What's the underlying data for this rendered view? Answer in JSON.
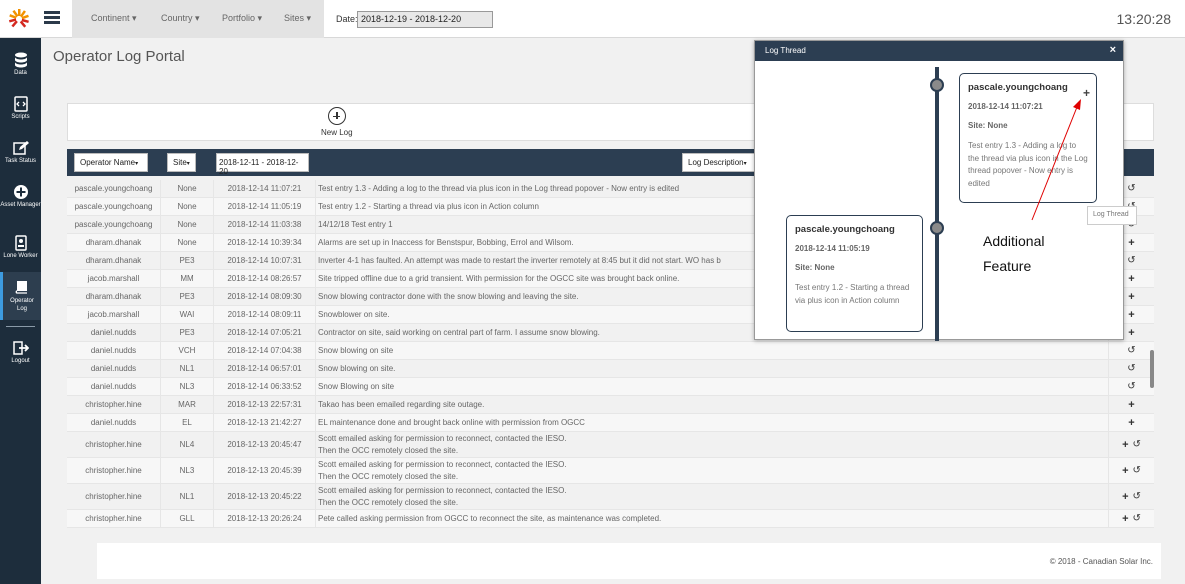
{
  "topbar": {
    "filters": [
      "Continent",
      "Country",
      "Portfolio",
      "Sites"
    ],
    "date_label": "Date:",
    "date_value": "2018-12-19 - 2018-12-20",
    "clock": "13:20:28"
  },
  "sidebar": {
    "items": [
      {
        "label": "Data",
        "icon": "database-icon"
      },
      {
        "label": "Scripts",
        "icon": "script-icon"
      },
      {
        "label": "Task Status",
        "icon": "edit-icon"
      },
      {
        "label": "Asset Manager",
        "icon": "plus-circle-icon"
      },
      {
        "label": "Lone Worker",
        "icon": "badge-icon"
      },
      {
        "label": "Operator Log",
        "icon": "book-icon"
      },
      {
        "label": "Logout",
        "icon": "logout-icon"
      }
    ]
  },
  "page": {
    "title": "Operator Log Portal",
    "new_log_label": "New Log"
  },
  "table": {
    "header": {
      "operator": "Operator Name",
      "site": "Site",
      "date_range": "2018-12-11 - 2018-12-20",
      "description": "Log Description"
    },
    "rows": [
      {
        "op": "pascale.youngchoang",
        "site": "None",
        "date": "2018-12-14 11:07:21",
        "desc": "Test entry 1.3 - Adding a log to the thread via plus icon in the Log thread popover - Now entry is edited",
        "actions": "hist"
      },
      {
        "op": "pascale.youngchoang",
        "site": "None",
        "date": "2018-12-14 11:05:19",
        "desc": "Test entry 1.2 - Starting a thread via plus icon in Action column",
        "actions": "hist"
      },
      {
        "op": "pascale.youngchoang",
        "site": "None",
        "date": "2018-12-14 11:03:38",
        "desc": "14/12/18 Test entry 1",
        "actions": "hist"
      },
      {
        "op": "dharam.dhanak",
        "site": "None",
        "date": "2018-12-14 10:39:34",
        "desc": "Alarms are set up in Inaccess for Benstspur, Bobbing, Errol and Wilsom.",
        "actions": "plus"
      },
      {
        "op": "dharam.dhanak",
        "site": "PE3",
        "date": "2018-12-14 10:07:31",
        "desc": "Inverter 4-1 has faulted. An attempt was made to restart the inverter remotely at 8:45 but it did not start. WO has b",
        "actions": "hist"
      },
      {
        "op": "jacob.marshall",
        "site": "MM",
        "date": "2018-12-14 08:26:57",
        "desc": "Site tripped offline due to a grid transient. With permission for the OGCC site was brought back online.",
        "actions": "plus"
      },
      {
        "op": "dharam.dhanak",
        "site": "PE3",
        "date": "2018-12-14 08:09:30",
        "desc": "Snow blowing contractor done with the snow blowing and leaving the site.",
        "actions": "plus"
      },
      {
        "op": "jacob.marshall",
        "site": "WAI",
        "date": "2018-12-14 08:09:11",
        "desc": "Snowblower on site.",
        "actions": "plus"
      },
      {
        "op": "daniel.nudds",
        "site": "PE3",
        "date": "2018-12-14 07:05:21",
        "desc": "Contractor on site, said working on central part of farm. I assume snow blowing.",
        "actions": "plus"
      },
      {
        "op": "daniel.nudds",
        "site": "VCH",
        "date": "2018-12-14 07:04:38",
        "desc": "Snow blowing on site",
        "actions": "hist"
      },
      {
        "op": "daniel.nudds",
        "site": "NL1",
        "date": "2018-12-14 06:57:01",
        "desc": "Snow blowing on site.",
        "actions": "hist"
      },
      {
        "op": "daniel.nudds",
        "site": "NL3",
        "date": "2018-12-14 06:33:52",
        "desc": "Snow Blowing on site",
        "actions": "hist"
      },
      {
        "op": "christopher.hine",
        "site": "MAR",
        "date": "2018-12-13 22:57:31",
        "desc": "Takao has been emailed regarding site outage.",
        "actions": "plus"
      },
      {
        "op": "daniel.nudds",
        "site": "EL",
        "date": "2018-12-13 21:42:27",
        "desc": "EL maintenance done and brought back online with permission from OGCC",
        "actions": "plus"
      },
      {
        "op": "christopher.hine",
        "site": "NL4",
        "date": "2018-12-13 20:45:47",
        "desc": "Scott emailed asking for permission to reconnect, contacted the IESO.\nThen the OCC remotely closed the site.",
        "actions": "both"
      },
      {
        "op": "christopher.hine",
        "site": "NL3",
        "date": "2018-12-13 20:45:39",
        "desc": "Scott emailed asking for permission to reconnect, contacted the IESO.\nThen the OCC remotely closed the site.",
        "actions": "both"
      },
      {
        "op": "christopher.hine",
        "site": "NL1",
        "date": "2018-12-13 20:45:22",
        "desc": "Scott emailed asking for permission to reconnect, contacted the IESO.\nThen the OCC remotely closed the site.",
        "actions": "both"
      },
      {
        "op": "christopher.hine",
        "site": "GLL",
        "date": "2018-12-13 20:26:24",
        "desc": "Pete called asking permission from OGCC to reconnect the site, as maintenance was completed.",
        "actions": "both"
      }
    ]
  },
  "popover": {
    "title": "Log Thread",
    "close": "×",
    "cards": [
      {
        "user": "pascale.youngchoang",
        "date": "2018-12-14 11:07:21",
        "site": "Site: None",
        "text": "Test entry 1.3 - Adding a log to the thread via plus icon in the Log thread popover - Now entry is edited"
      },
      {
        "user": "pascale.youngchoang",
        "date": "2018-12-14 11:05:19",
        "site": "Site: None",
        "text": "Test entry 1.2 - Starting a thread via plus icon in Action column"
      }
    ]
  },
  "tooltip": "Log Thread",
  "annotation": {
    "line1": "Additional",
    "line2": "Feature",
    "color": "#e00000"
  },
  "footer": "© 2018 - Canadian Solar Inc.",
  "icons": {
    "plus": "+",
    "history": "↺"
  }
}
